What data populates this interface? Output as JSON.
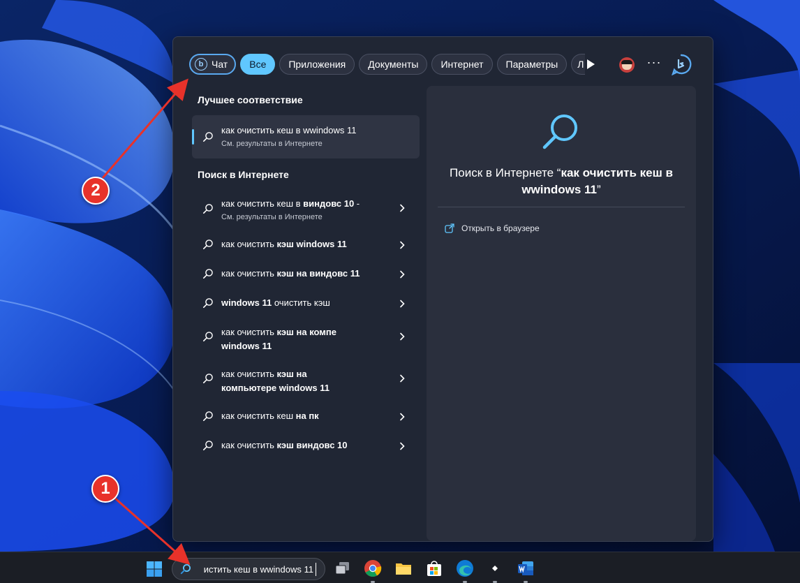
{
  "filters": [
    {
      "label": "Чат",
      "name": "chat"
    },
    {
      "label": "Все",
      "name": "all"
    },
    {
      "label": "Приложения",
      "name": "apps"
    },
    {
      "label": "Документы",
      "name": "documents"
    },
    {
      "label": "Интернет",
      "name": "internet"
    },
    {
      "label": "Параметры",
      "name": "settings"
    },
    {
      "label": "Л",
      "name": "more-partial"
    }
  ],
  "active_filter": "Все",
  "header_icons": [
    "play-icon",
    "avatar-icon",
    "more-options-icon",
    "bing-icon"
  ],
  "best_match": {
    "heading": "Лучшее соответствие",
    "title": "как очистить кеш в wwindows 11",
    "subtitle": "См. результаты в Интернете"
  },
  "web_search": {
    "heading": "Поиск в Интернете",
    "items": [
      {
        "plain": "как очистить кеш в ",
        "bold": "виндовс 10",
        "rest": " -",
        "sub": "См. результаты в Интернете"
      },
      {
        "plain": "как очистить ",
        "bold": "кэш windows 11",
        "rest": "",
        "sub": ""
      },
      {
        "plain": "как очистить ",
        "bold": "кэш на виндовс 11",
        "rest": "",
        "sub": ""
      },
      {
        "plain": "",
        "bold": "windows 11",
        "rest": " очистить кэш",
        "sub": ""
      },
      {
        "plain": "как очистить ",
        "bold": "кэш на компе",
        "rest": "",
        "line2": "windows 11",
        "sub": ""
      },
      {
        "plain": "как очистить ",
        "bold": "кэш на",
        "rest": "",
        "line2": "компьютере windows 11",
        "sub": ""
      },
      {
        "plain": "как очистить кеш ",
        "bold": "на пк",
        "rest": "",
        "sub": ""
      },
      {
        "plain": "как очистить ",
        "bold": "кэш виндовс 10",
        "rest": "",
        "sub": ""
      }
    ]
  },
  "preview": {
    "title_prefix": "Поиск в Интернете “",
    "query": "как очистить кеш в wwindows 11",
    "title_suffix": "”",
    "open_in_browser": "Открыть в браузере"
  },
  "taskbar": {
    "search_text": "истить кеш в wwindows 11",
    "apps": [
      "start-icon",
      "task-view-icon",
      "chrome-icon",
      "file-explorer-icon",
      "store-icon",
      "edge-icon",
      "app-icon",
      "word-icon"
    ]
  },
  "annotations": [
    {
      "number": "1"
    },
    {
      "number": "2"
    }
  ],
  "colors": {
    "accent": "#60c7ff",
    "panel": "#202634",
    "annotation": "#e8322a"
  }
}
